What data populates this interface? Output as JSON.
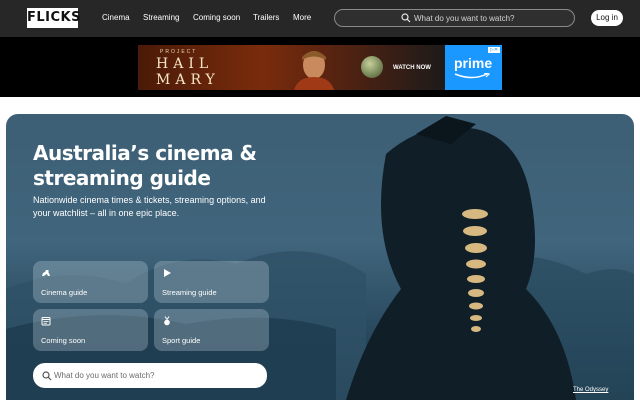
{
  "header": {
    "logo": "FLICKS",
    "nav": [
      {
        "label": "Cinema"
      },
      {
        "label": "Streaming"
      },
      {
        "label": "Coming soon"
      },
      {
        "label": "Trailers"
      },
      {
        "label": "More"
      }
    ],
    "search_placeholder": "What do you want to watch?",
    "login_label": "Log in"
  },
  "ad": {
    "project_text": "PROJECT",
    "title_line1": "HAIL",
    "title_line2": "MARY",
    "watch_label": "WATCH NOW",
    "brand": "prime"
  },
  "hero": {
    "title": "Australia’s cinema & streaming guide",
    "subtitle": "Nationwide cinema times & tickets, streaming options, and your watchlist – all in one epic place.",
    "tiles": [
      {
        "label": "Cinema guide",
        "icon": "dinosaur-icon"
      },
      {
        "label": "Streaming guide",
        "icon": "play-icon"
      },
      {
        "label": "Coming soon",
        "icon": "calendar-icon"
      },
      {
        "label": "Sport guide",
        "icon": "medal-icon"
      }
    ],
    "search_placeholder": "What do you want to watch?",
    "credit": "The Odyssey"
  },
  "colors": {
    "topbar": "#272727",
    "hero_base": "#3d5f75",
    "prime_blue": "#1a98ff"
  }
}
